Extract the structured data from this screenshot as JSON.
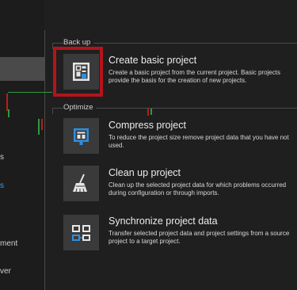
{
  "left_nav": {
    "items": [
      "s",
      "s",
      "ment",
      "ver"
    ]
  },
  "sections": {
    "backup": "Back up",
    "optimize": "Optimize"
  },
  "actions": [
    {
      "title": "Create basic project",
      "description": "Create a basic project from the current project. Basic projects provide the basis for the creation of new projects.",
      "icon": "basic-project-icon"
    },
    {
      "title": "Compress project",
      "description": "To reduce the project size remove project data that you have not used.",
      "icon": "compress-project-icon"
    },
    {
      "title": "Clean up project",
      "description": "Clean up the selected project data for which problems occurred during configuration or through imports.",
      "icon": "broom-icon"
    },
    {
      "title": "Synchronize project data",
      "description": "Transfer selected project data and project settings from a source project to a target project.",
      "icon": "sync-project-icon"
    }
  ],
  "colors": {
    "accent": "#3aa0ff",
    "highlight": "#b3141b",
    "tile": "#3a3a3a",
    "background": "#1f1f1f"
  }
}
